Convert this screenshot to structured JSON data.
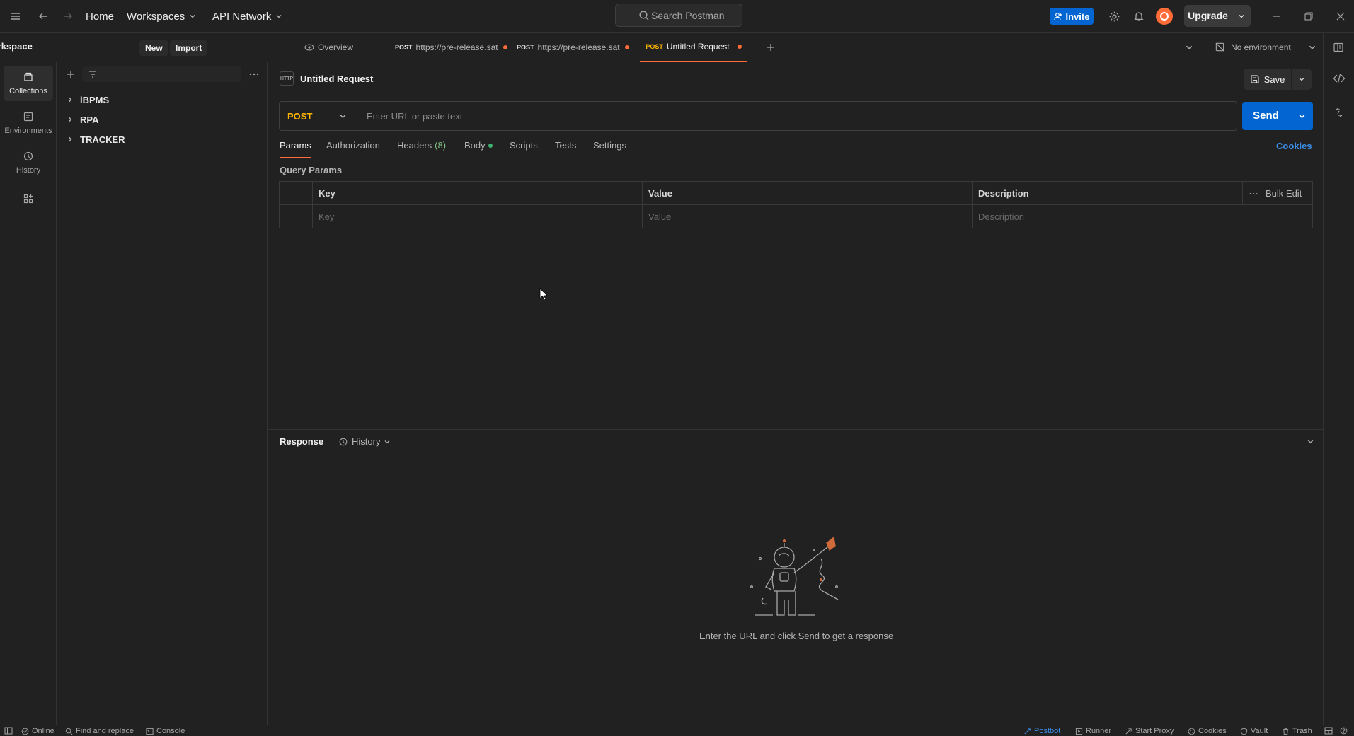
{
  "topbar": {
    "nav": {
      "home": "Home",
      "workspaces": "Workspaces",
      "api_network": "API Network"
    },
    "search_placeholder": "Search Postman",
    "invite_label": "Invite",
    "upgrade_label": "Upgrade"
  },
  "rail": {
    "items": [
      {
        "label": "Collections",
        "icon": "collections-icon",
        "active": true
      },
      {
        "label": "Environments",
        "icon": "environments-icon"
      },
      {
        "label": "History",
        "icon": "history-icon"
      }
    ]
  },
  "sidebar": {
    "workspace_name": "My Workspace",
    "new_label": "New",
    "import_label": "Import",
    "collections": [
      "iBPMS",
      "RPA",
      "TRACKER"
    ]
  },
  "tabs": [
    {
      "label": "Overview",
      "method": ""
    },
    {
      "label": "https://pre-release.sat",
      "method": "POST"
    },
    {
      "label": "https://pre-release.sat",
      "method": "POST"
    },
    {
      "label": "Untitled Request",
      "method": "POST",
      "active": true
    }
  ],
  "environment": {
    "label": "No environment"
  },
  "request": {
    "title": "Untitled Request",
    "badge": "HTTP",
    "save_label": "Save",
    "method": "POST",
    "url_placeholder": "Enter URL or paste text",
    "send_label": "Send",
    "subtabs": {
      "params": "Params",
      "authorization": "Authorization",
      "headers": "Headers",
      "headers_count": "(8)",
      "body": "Body",
      "scripts": "Scripts",
      "tests": "Tests",
      "settings": "Settings"
    },
    "cookies_label": "Cookies",
    "query_params": {
      "label": "Query Params",
      "columns": {
        "key": "Key",
        "value": "Value",
        "description": "Description"
      },
      "bulk_edit": "Bulk Edit",
      "placeholders": {
        "key": "Key",
        "value": "Value",
        "description": "Description"
      }
    }
  },
  "response": {
    "label": "Response",
    "history_label": "History",
    "empty_message": "Enter the URL and click Send to get a response"
  },
  "statusbar": {
    "online": "Online",
    "find_replace": "Find and replace",
    "console": "Console",
    "postbot": "Postbot",
    "runner": "Runner",
    "start_proxy": "Start Proxy",
    "cookies": "Cookies",
    "vault": "Vault",
    "trash": "Trash"
  },
  "colors": {
    "accent": "#ff6c37",
    "primary": "#0265d2",
    "method_post": "#ffb400",
    "link": "#3b8eea"
  }
}
